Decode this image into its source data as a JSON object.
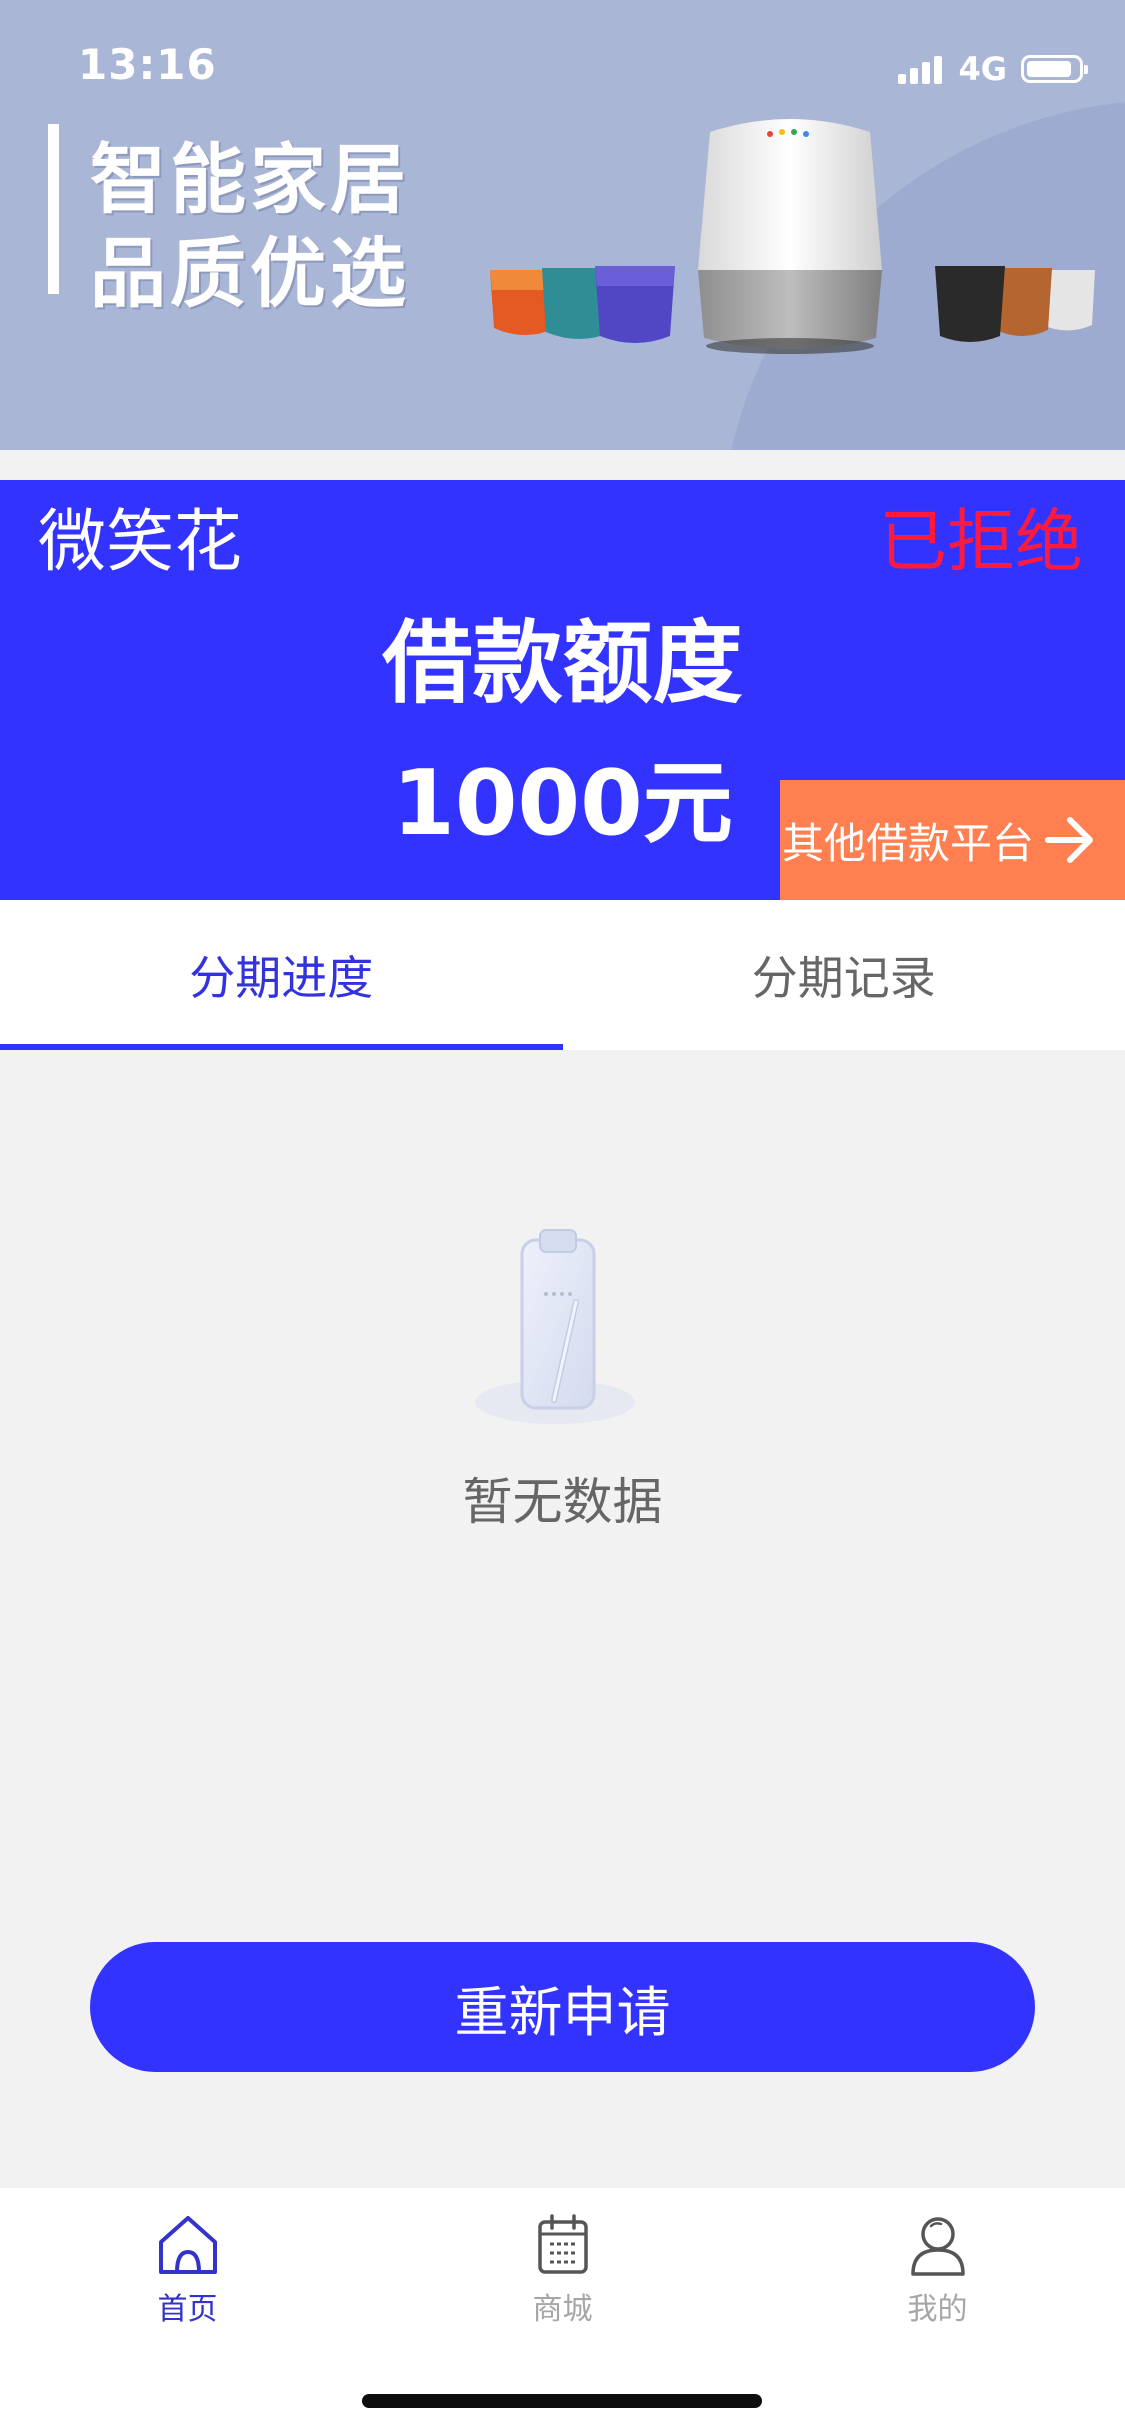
{
  "status_bar": {
    "time": "13:16",
    "network": "4G",
    "icons": [
      "signal-icon",
      "battery-icon"
    ]
  },
  "banner": {
    "line1": "智能家居",
    "line2": "品质优选",
    "image": "smart-speakers-image"
  },
  "loan_panel": {
    "brand": "微笑花",
    "status": "已拒绝",
    "label": "借款额度",
    "amount": "1000元",
    "other_platform": "其他借款平台",
    "colors": {
      "panel": "#3333ff",
      "status": "#ff1a3d",
      "other_platform": "#ff7f50"
    }
  },
  "tabs": [
    {
      "label": "分期进度",
      "active": true
    },
    {
      "label": "分期记录",
      "active": false
    }
  ],
  "empty_state": {
    "text": "暂无数据",
    "icon": "clipboard-icon"
  },
  "reapply_button": "重新申请",
  "bottom_nav": [
    {
      "label": "首页",
      "icon": "home-icon",
      "active": true
    },
    {
      "label": "商城",
      "icon": "calendar-icon",
      "active": false
    },
    {
      "label": "我的",
      "icon": "user-icon",
      "active": false
    }
  ],
  "theme": {
    "accent": "#3333ff",
    "background": "#f2f2f2"
  }
}
